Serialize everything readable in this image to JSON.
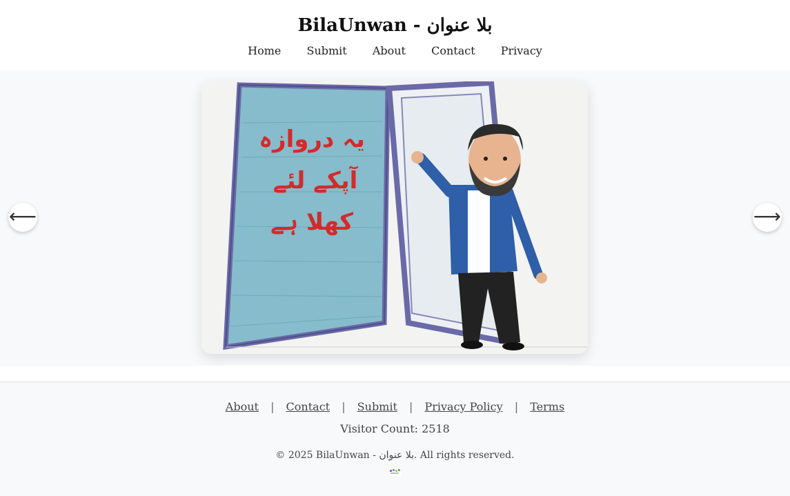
{
  "header": {
    "title": "BilaUnwan - بلا عنوان",
    "nav": [
      "Home",
      "Submit",
      "About",
      "Contact",
      "Privacy"
    ]
  },
  "carousel": {
    "prev_symbol": "⟵",
    "next_symbol": "⟶",
    "slide_text_lines": [
      "یہ دروازہ",
      "آپکے لئے",
      "کھلا ہے"
    ],
    "colors": {
      "door": "#7fb6c4",
      "frame": "#6a6aa8",
      "text": "#d42a2a",
      "shirt": "#2e5fa8"
    }
  },
  "footer": {
    "links": [
      "About",
      "Contact",
      "Submit",
      "Privacy Policy",
      "Terms"
    ],
    "separator": "|",
    "visitor_label": "Visitor Count: 2518",
    "copyright": "© 2025 BilaUnwan - بلا عنوان. All rights reserved."
  }
}
